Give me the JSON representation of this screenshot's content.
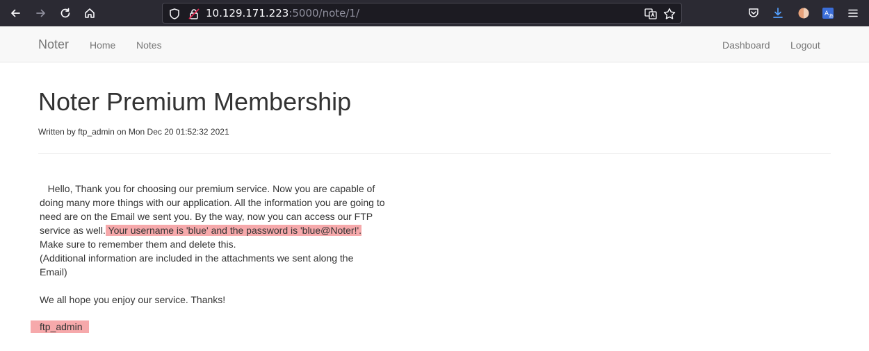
{
  "browser": {
    "url_host": "10.129.171.223",
    "url_path": ":5000/note/1/"
  },
  "navbar": {
    "brand": "Noter",
    "links": [
      "Home",
      "Notes"
    ],
    "right_links": [
      "Dashboard",
      "Logout"
    ]
  },
  "note": {
    "title": "Noter Premium Membership",
    "byline": "Written by ftp_admin on Mon Dec 20 01:52:32 2021",
    "body_intro": "Hello, Thank you for choosing our premium service. Now you are capable of doing many more things with our application. All the information you are going to need are on the Email we sent you. By the way, now you can access our FTP service as well.",
    "body_highlight": " Your username is 'blue' and the password is 'blue@Noter!'.",
    "body_line2": "Make sure to remember them and delete this.",
    "body_line3": "(Additional information are included in the attachments we sent along the Email)",
    "body_line4": "We all hope you enjoy our service. Thanks!",
    "signature": "ftp_admin"
  },
  "colors": {
    "highlight": "#f6a9ab",
    "browser_chrome": "#2b2a33"
  }
}
